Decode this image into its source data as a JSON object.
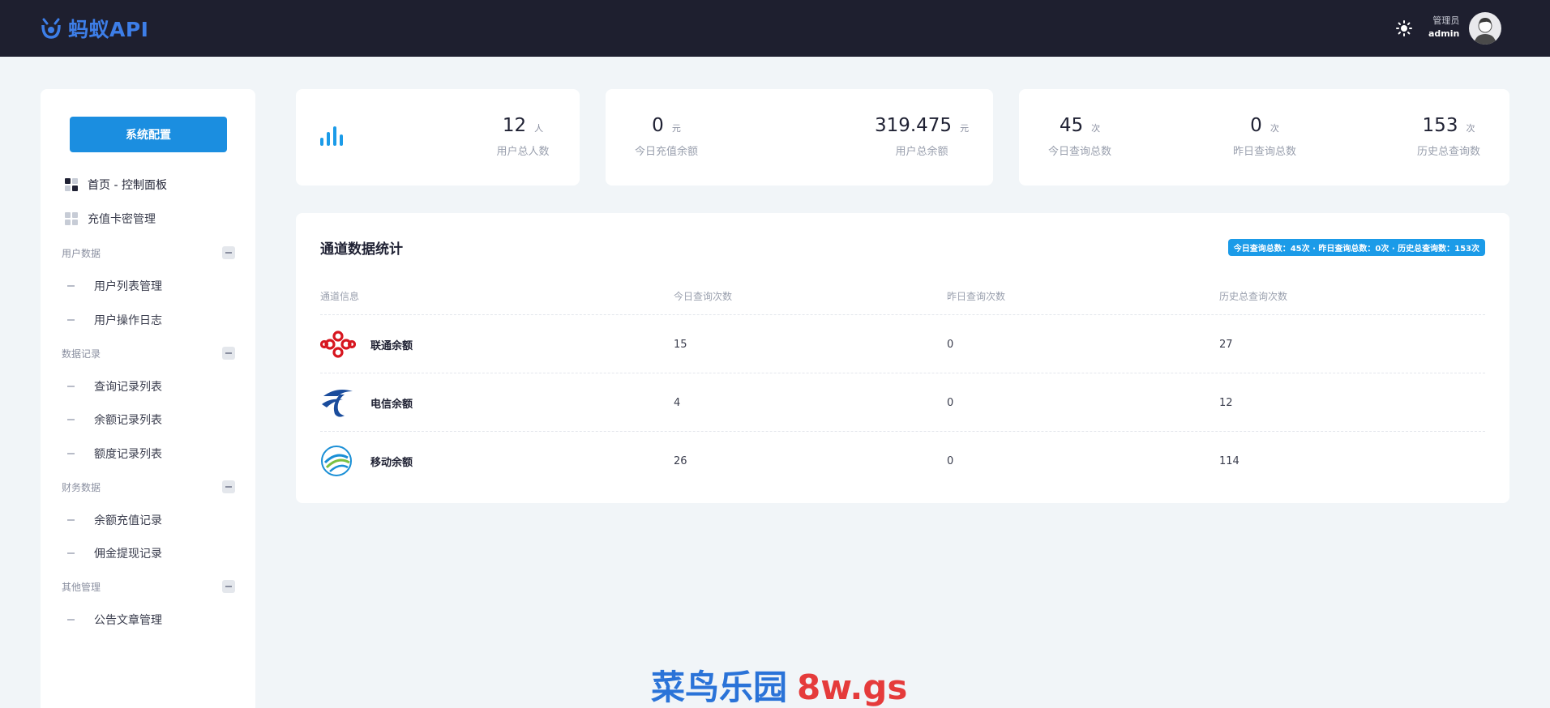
{
  "header": {
    "logo_text": "蚂蚁API",
    "user_role": "管理员",
    "user_name": "admin"
  },
  "sidebar": {
    "config_button": "系统配置",
    "top_items": [
      {
        "label": "首页 - 控制面板",
        "active": true
      },
      {
        "label": "充值卡密管理",
        "active": false
      }
    ],
    "groups": [
      {
        "title": "用户数据",
        "items": [
          "用户列表管理",
          "用户操作日志"
        ]
      },
      {
        "title": "数据记录",
        "items": [
          "查询记录列表",
          "余额记录列表",
          "额度记录列表"
        ]
      },
      {
        "title": "财务数据",
        "items": [
          "余额充值记录",
          "佣金提现记录"
        ]
      },
      {
        "title": "其他管理",
        "items": [
          "公告文章管理"
        ]
      }
    ]
  },
  "stats": {
    "users_total": {
      "value": "12",
      "unit": "人",
      "label": "用户总人数"
    },
    "today_recharge": {
      "value": "0",
      "unit": "元",
      "label": "今日充值余额"
    },
    "user_balance": {
      "value": "319.475",
      "unit": "元",
      "label": "用户总余额"
    },
    "today_queries": {
      "value": "45",
      "unit": "次",
      "label": "今日查询总数"
    },
    "yesterday_queries": {
      "value": "0",
      "unit": "次",
      "label": "昨日查询总数"
    },
    "history_queries": {
      "value": "153",
      "unit": "次",
      "label": "历史总查询数"
    }
  },
  "channel_table": {
    "title": "通道数据统计",
    "summary": "今日查询总数：45次 · 昨日查询总数：0次 · 历史总查询数：153次",
    "headers": [
      "通道信息",
      "今日查询次数",
      "昨日查询次数",
      "历史总查询次数"
    ],
    "rows": [
      {
        "name": "联通余额",
        "today": "15",
        "yesterday": "0",
        "history": "27",
        "logo": "china-unicom-logo"
      },
      {
        "name": "电信余额",
        "today": "4",
        "yesterday": "0",
        "history": "12",
        "logo": "china-telecom-logo"
      },
      {
        "name": "移动余额",
        "today": "26",
        "yesterday": "0",
        "history": "114",
        "logo": "china-mobile-logo"
      }
    ]
  },
  "watermark": {
    "text_a": "菜鸟乐园",
    "text_b": "8w.gs"
  },
  "colors": {
    "header_bg": "#1e1f2f",
    "accent": "#1b8ee0",
    "badge": "#1b9be8",
    "logo_blue": "#3d7ee8"
  }
}
